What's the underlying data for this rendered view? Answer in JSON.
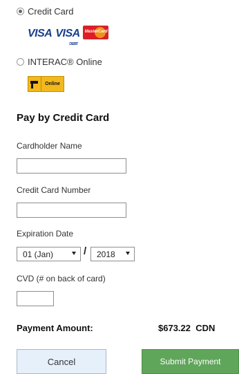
{
  "payment_options": {
    "credit_card": {
      "label": "Credit Card",
      "selected": true,
      "logos": {
        "visa": "VISA",
        "visa_debit": "VISA",
        "visa_debit_sub": "DEBIT",
        "mastercard": "MasterCard"
      }
    },
    "interac": {
      "label": "INTERAC® Online",
      "selected": false,
      "logo_text": "Online"
    }
  },
  "form": {
    "title": "Pay by Credit Card",
    "cardholder_label": "Cardholder Name",
    "cardholder_value": "",
    "card_number_label": "Credit Card Number",
    "card_number_value": "",
    "expiration_label": "Expiration Date",
    "exp_month": "01 (Jan)",
    "exp_separator": "/",
    "exp_year": "2018",
    "cvd_label": "CVD (# on back of card)",
    "cvd_value": ""
  },
  "payment": {
    "amount_label": "Payment Amount:",
    "amount_value": "$673.22  CDN"
  },
  "buttons": {
    "cancel": "Cancel",
    "submit": "Submit Payment"
  },
  "colors": {
    "submit_bg": "#5fa55a",
    "cancel_bg": "#e6f0fb",
    "visa_blue": "#1a3e8c"
  }
}
